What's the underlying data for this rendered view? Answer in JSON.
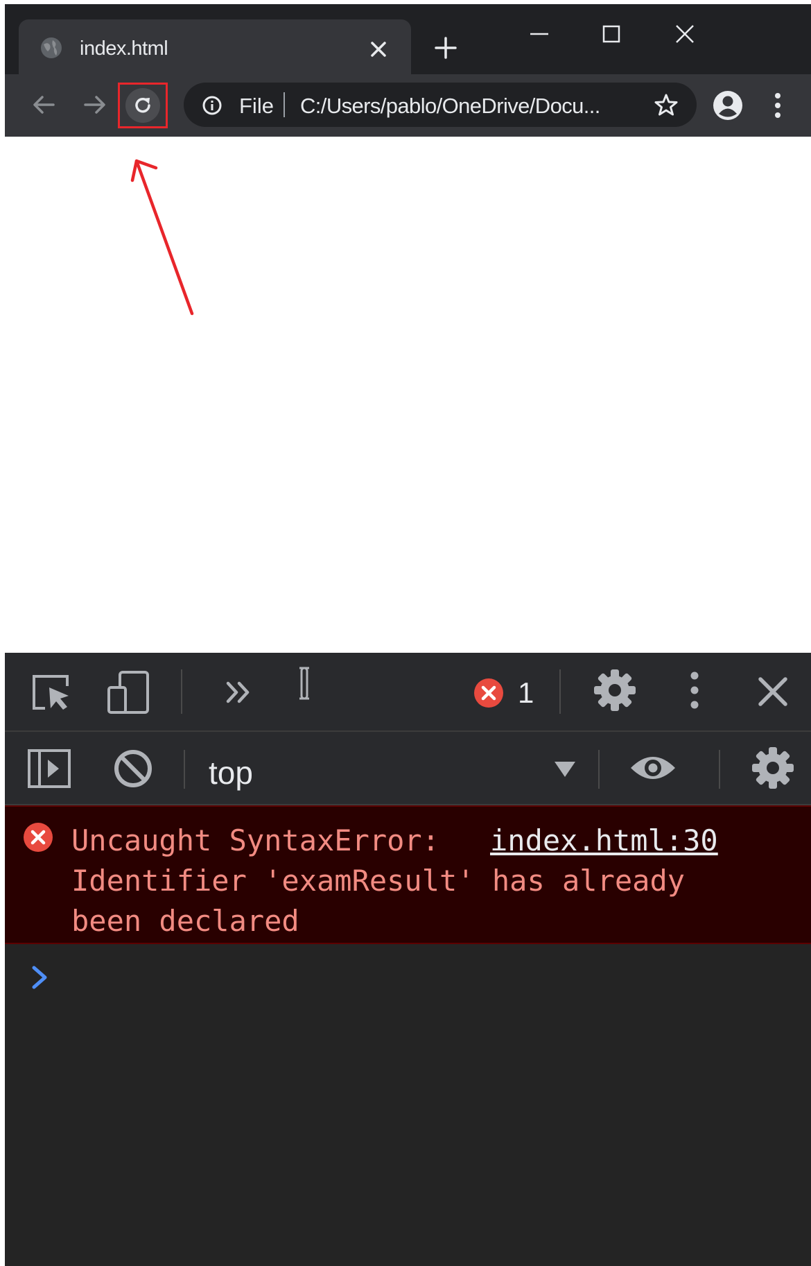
{
  "tab": {
    "title": "index.html"
  },
  "omnibox": {
    "scheme": "File",
    "url": "C:/Users/pablo/OneDrive/Docu..."
  },
  "devtools": {
    "error_count": "1",
    "context": "top",
    "error": {
      "line1": "Uncaught SyntaxError:",
      "source_link": "index.html:30",
      "line2": "Identifier 'examResult' has already",
      "line3": "been declared"
    }
  },
  "colors": {
    "chrome_dark": "#202124",
    "chrome_toolbar": "#35363a",
    "devtools_bg": "#242424",
    "error_bg": "#290000",
    "error_text": "#f28b82",
    "annotation_red": "#e8262b",
    "prompt_blue": "#4f8ff7"
  },
  "icons": [
    "globe-icon",
    "close-icon",
    "plus-icon",
    "minimize-icon",
    "maximize-icon",
    "back-arrow-icon",
    "forward-arrow-icon",
    "reload-icon",
    "info-icon",
    "star-icon",
    "profile-icon",
    "kebab-menu-icon",
    "inspect-element-icon",
    "device-toolbar-icon",
    "more-tabs-icon",
    "drag-handle-icon",
    "error-icon",
    "gear-icon",
    "sidebar-icon",
    "clear-console-icon",
    "dropdown-arrow-icon",
    "eye-icon",
    "prompt-chevron-icon"
  ]
}
